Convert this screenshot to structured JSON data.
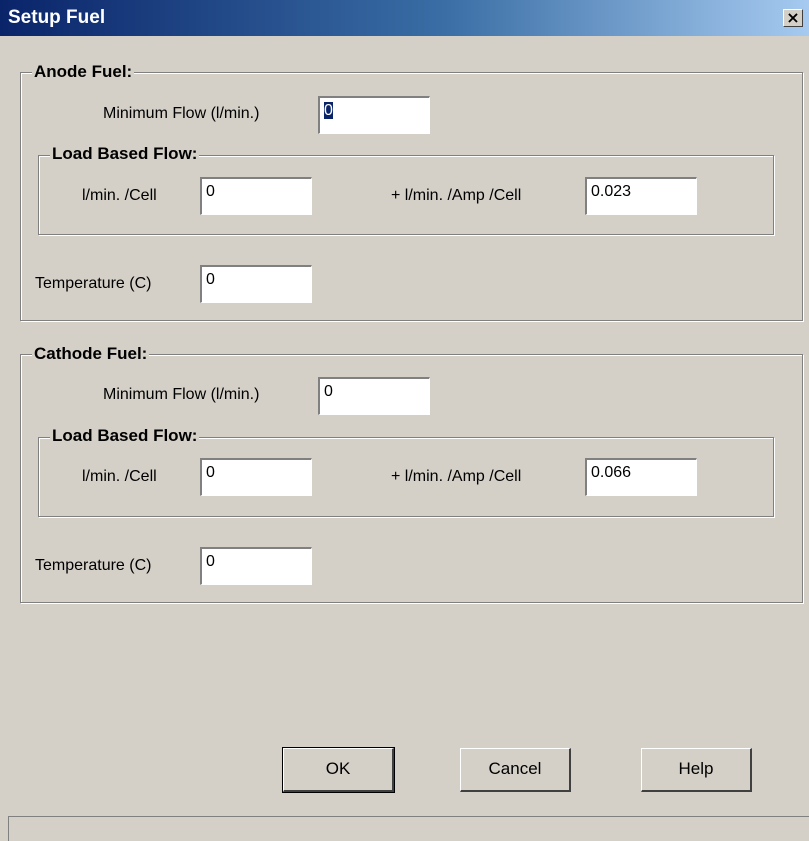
{
  "window": {
    "title": "Setup Fuel",
    "close_glyph": "×"
  },
  "anode": {
    "group_label": "Anode Fuel:",
    "min_flow_label": "Minimum Flow (l/min.)",
    "min_flow_value": "0",
    "load_group_label": "Load Based Flow:",
    "per_cell_label": "l/min. /Cell",
    "per_cell_value": "0",
    "per_amp_label": "+ l/min. /Amp /Cell",
    "per_amp_value": "0.023",
    "temp_label": "Temperature (C)",
    "temp_value": "0"
  },
  "cathode": {
    "group_label": "Cathode Fuel:",
    "min_flow_label": "Minimum Flow (l/min.)",
    "min_flow_value": "0",
    "load_group_label": "Load Based Flow:",
    "per_cell_label": "l/min. /Cell",
    "per_cell_value": "0",
    "per_amp_label": "+ l/min. /Amp /Cell",
    "per_amp_value": "0.066",
    "temp_label": "Temperature (C)",
    "temp_value": "0"
  },
  "buttons": {
    "ok": "OK",
    "cancel": "Cancel",
    "help": "Help"
  }
}
